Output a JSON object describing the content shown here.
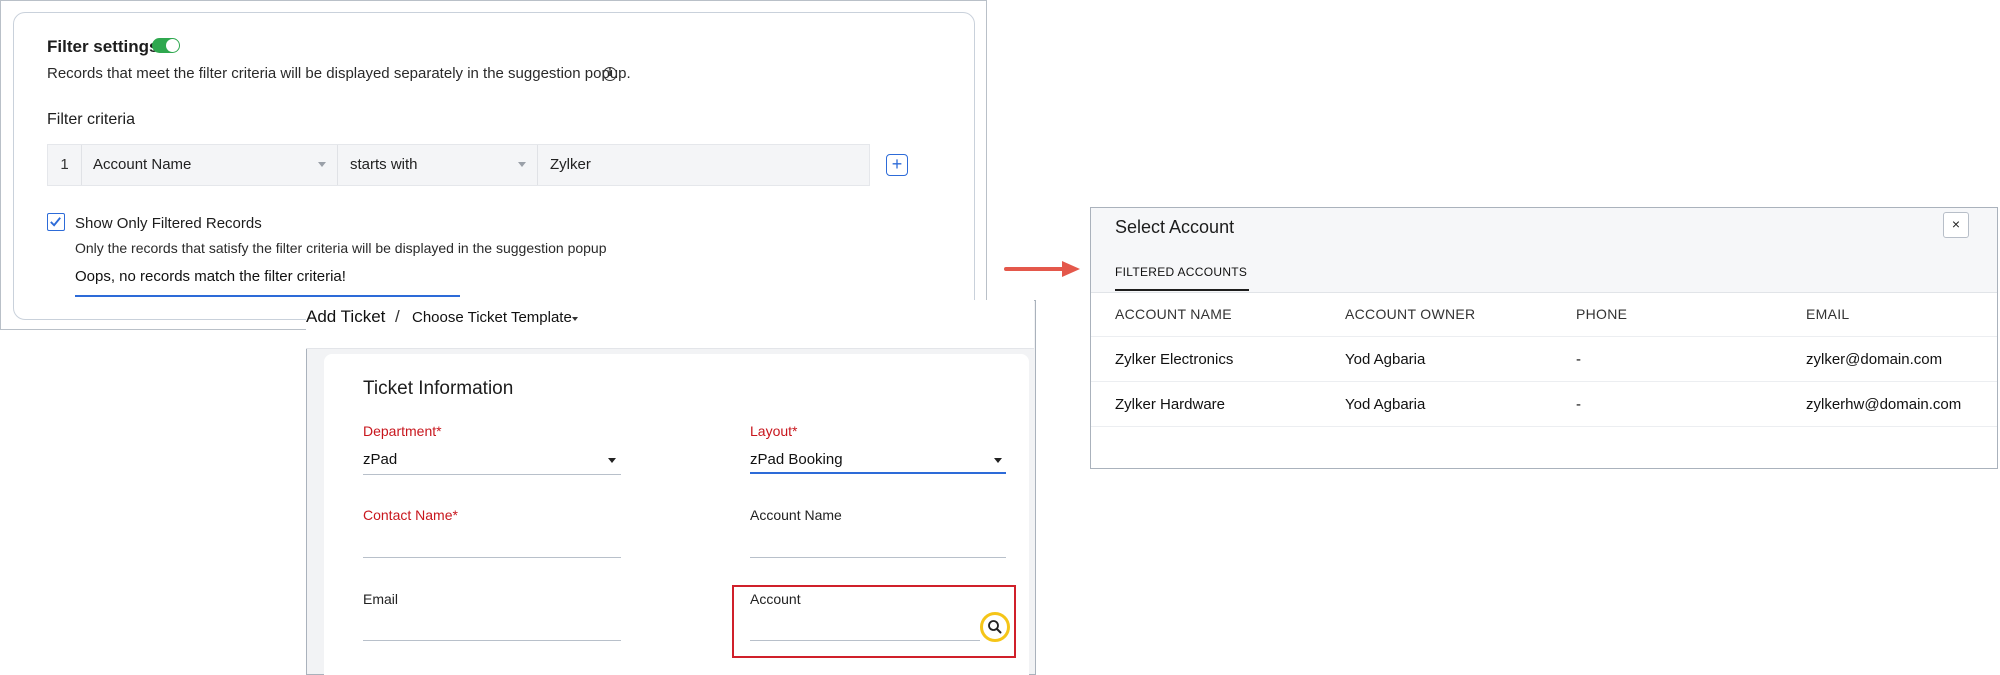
{
  "filter_settings": {
    "title": "Filter settings",
    "toggle_on": true,
    "description": "Records that meet the filter criteria will be displayed separately in the suggestion popup.",
    "info_icon": "info-icon",
    "criteria_label": "Filter criteria",
    "criteria": {
      "number": "1",
      "field": "Account Name",
      "operator": "starts with",
      "value": "Zylker"
    },
    "add_icon": "+",
    "show_only": {
      "checked": true,
      "label": "Show Only Filtered Records",
      "description": "Only the records that satisfy the filter criteria will be displayed in the suggestion popup",
      "message": "Oops, no records match the filter criteria!"
    }
  },
  "ticket": {
    "breadcrumb_title": "Add Ticket",
    "separator": "/",
    "template_selector": "Choose Ticket Template",
    "section_title": "Ticket Information",
    "fields": {
      "department_label": "Department",
      "department_value": "zPad",
      "layout_label": "Layout",
      "layout_value": "zPad Booking",
      "contact_label": "Contact Name",
      "account_name_label": "Account Name",
      "email_label": "Email",
      "account_label": "Account",
      "required_marker": "*"
    }
  },
  "modal": {
    "title": "Select Account",
    "close_icon": "×",
    "tab": "FILTERED ACCOUNTS",
    "columns": [
      "ACCOUNT NAME",
      "ACCOUNT OWNER",
      "PHONE",
      "EMAIL"
    ],
    "rows": [
      {
        "name": "Zylker Electronics",
        "owner": "Yod Agbaria",
        "phone": "-",
        "email": "zylker@domain.com"
      },
      {
        "name": "Zylker Hardware",
        "owner": "Yod Agbaria",
        "phone": "-",
        "email": "zylkerhw@domain.com"
      }
    ]
  },
  "colors": {
    "accent": "#2d6bd8",
    "required": "#c8161d",
    "toggle": "#2fa84f",
    "arrow": "#e4584b",
    "highlight_box": "#d0202a",
    "highlight_circle": "#f5c518"
  }
}
